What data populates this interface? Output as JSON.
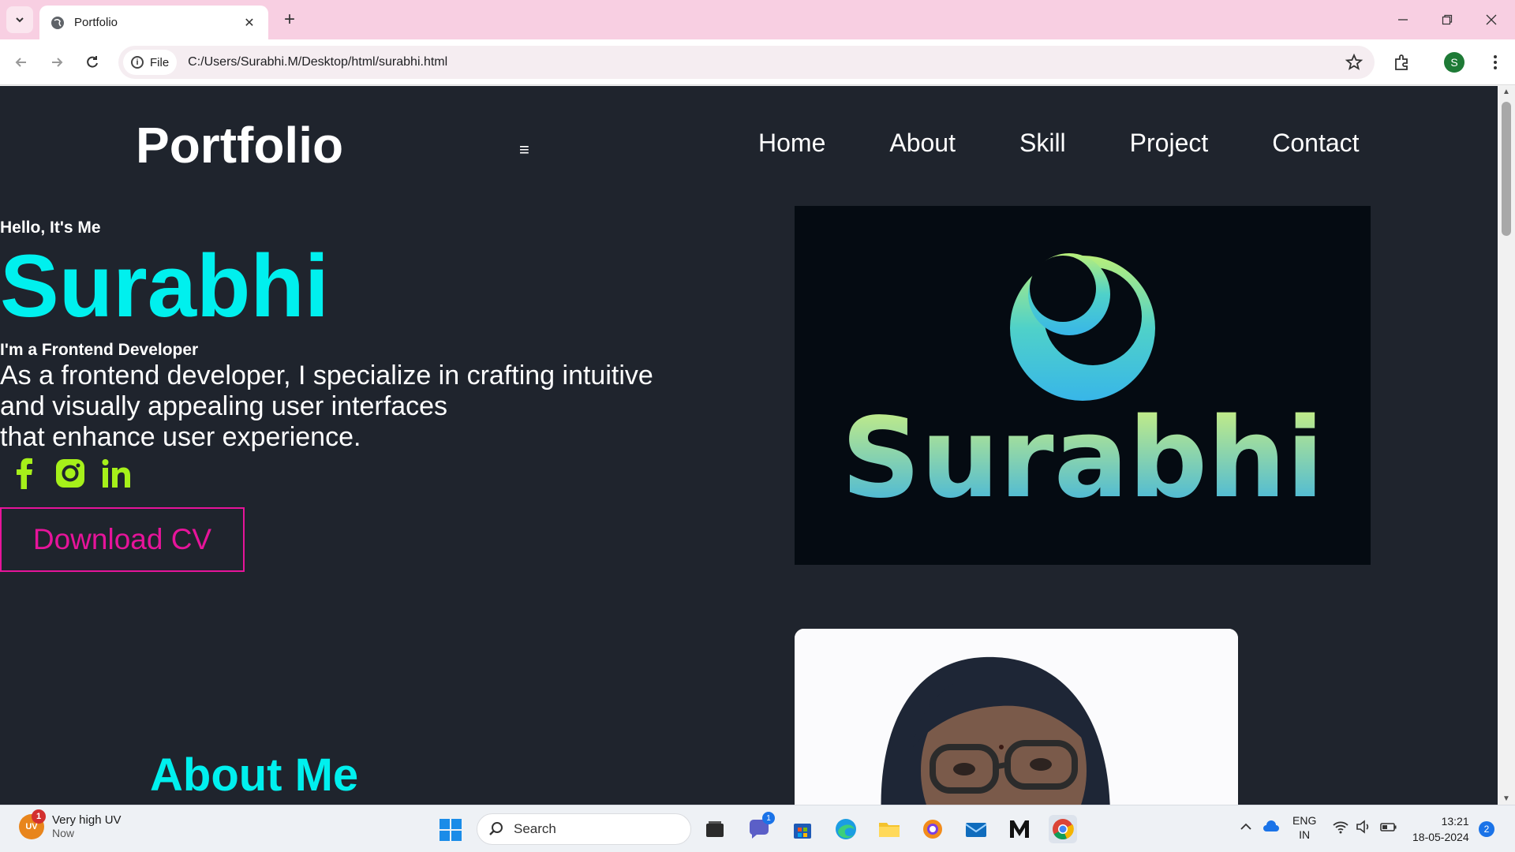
{
  "browser": {
    "tab_title": "Portfolio",
    "address_chip": "File",
    "url": "C:/Users/Surabhi.M/Desktop/html/surabhi.html",
    "profile_initial": "S"
  },
  "site": {
    "logo": "Portfolio",
    "menu_icon": "≡",
    "nav": [
      "Home",
      "About",
      "Skill",
      "Project",
      "Contact"
    ],
    "hero": {
      "greeting": "Hello, It's Me",
      "name": "Surabhi",
      "role": "I'm a Frontend Developer",
      "description_lines": [
        "As a frontend developer, I specialize in crafting intuitive",
        "and visually appealing user interfaces",
        "that enhance user experience."
      ],
      "social_icons": [
        "facebook-icon",
        "instagram-icon",
        "linkedin-icon"
      ],
      "cta": "Download CV",
      "logo_text": "Surabhi"
    },
    "about_title": "About Me"
  },
  "colors": {
    "page_bg": "#1f242d",
    "accent_cyan": "#00f0ee",
    "cta_pink": "#e6149a",
    "social_green": "#a6f01a"
  },
  "taskbar": {
    "weather_title": "Very high UV",
    "weather_sub": "Now",
    "weather_badge": "1",
    "weather_icon_text": "UV",
    "search_label": "Search",
    "teams_badge": "1",
    "lang_1": "ENG",
    "lang_2": "IN",
    "time": "13:21",
    "date": "18-05-2024",
    "notifications": "2"
  }
}
